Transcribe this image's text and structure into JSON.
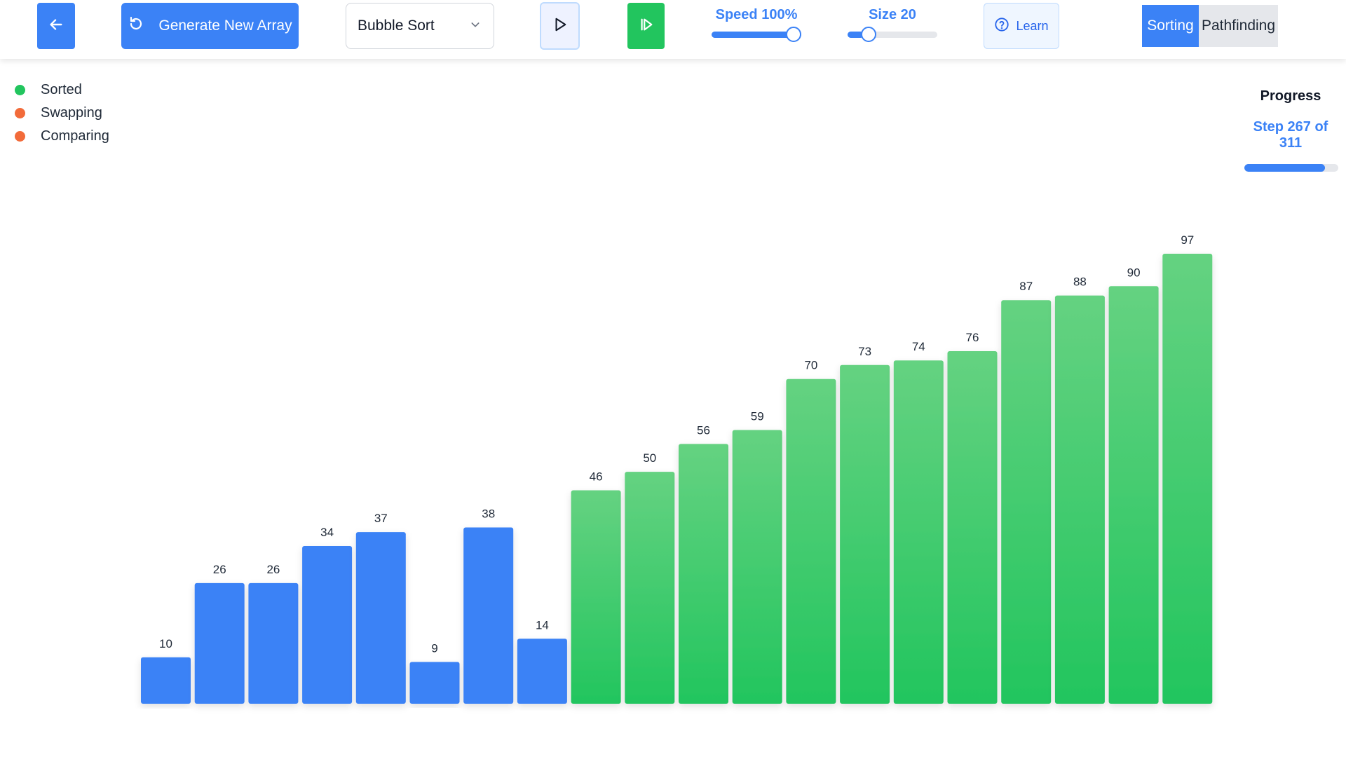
{
  "toolbar": {
    "generate_label": "Generate New Array",
    "algorithm": {
      "selected": "Bubble Sort"
    },
    "speed": {
      "label": "Speed 100%",
      "value_percent": 100
    },
    "size": {
      "label": "Size 20",
      "value": 20,
      "fraction": 0.18
    },
    "learn_label": "Learn",
    "modes": [
      {
        "label": "Sorting",
        "active": true
      },
      {
        "label": "Pathfinding",
        "active": false
      }
    ]
  },
  "legend": [
    {
      "label": "Sorted",
      "color": "#22c55e"
    },
    {
      "label": "Swapping",
      "color": "#f26b3a"
    },
    {
      "label": "Comparing",
      "color": "#f26b3a"
    }
  ],
  "progress": {
    "title": "Progress",
    "step_text": "Step 267 of 311",
    "current": 267,
    "total": 311
  },
  "colors": {
    "accent": "#3b82f6",
    "sorted_top": "#65d281",
    "sorted_bottom": "#22c55e",
    "unsorted": "#3b82f6"
  },
  "icons": {
    "back": "arrow-left-icon",
    "generate": "refresh-icon",
    "dropdown": "chevron-down-icon",
    "play": "play-icon",
    "step": "step-forward-icon",
    "learn": "help-circle-icon"
  },
  "chart_data": {
    "type": "bar",
    "values": [
      10,
      26,
      26,
      34,
      37,
      9,
      38,
      14,
      46,
      50,
      56,
      59,
      70,
      73,
      74,
      76,
      87,
      88,
      90,
      97
    ],
    "states": [
      "unsorted",
      "unsorted",
      "unsorted",
      "unsorted",
      "unsorted",
      "unsorted",
      "unsorted",
      "unsorted",
      "sorted",
      "sorted",
      "sorted",
      "sorted",
      "sorted",
      "sorted",
      "sorted",
      "sorted",
      "sorted",
      "sorted",
      "sorted",
      "sorted"
    ],
    "ylim": [
      0,
      97
    ]
  }
}
